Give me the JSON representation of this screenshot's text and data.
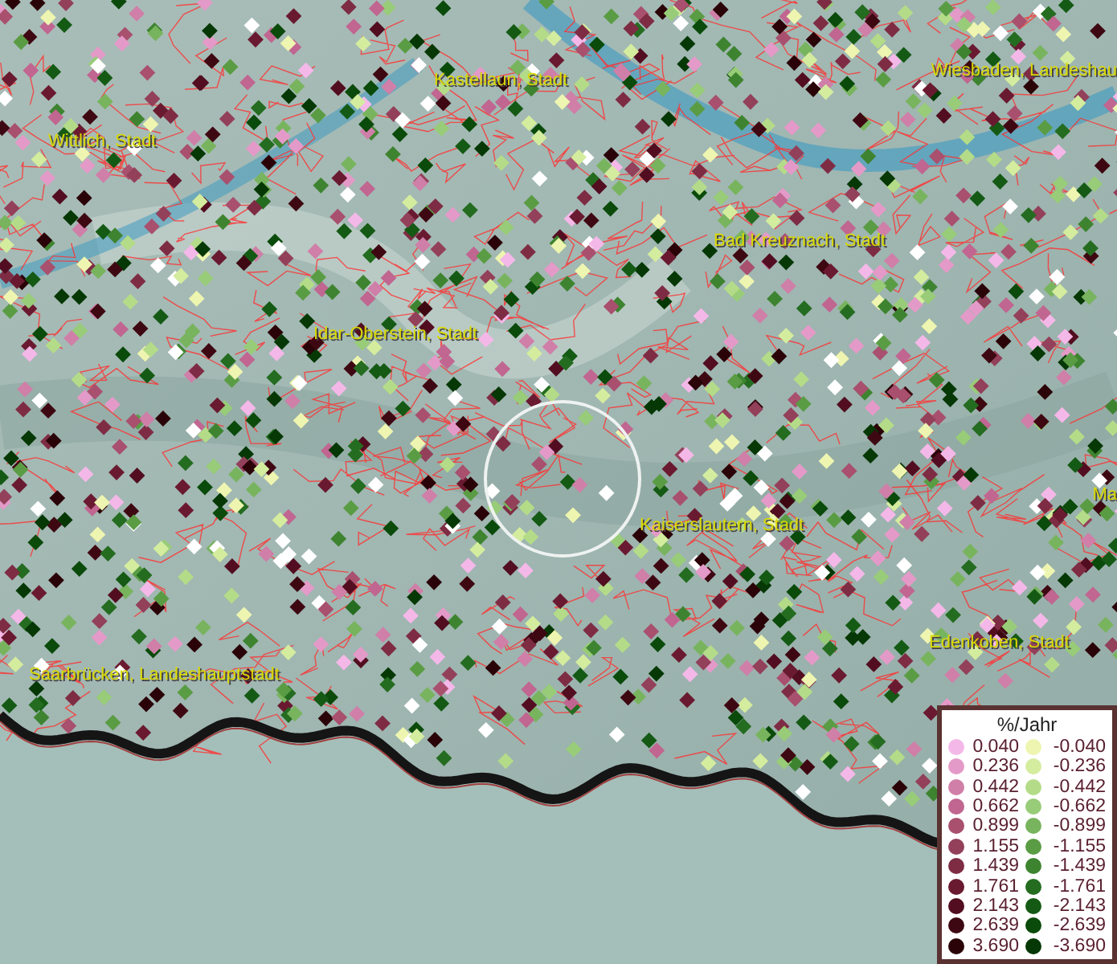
{
  "map": {
    "places": [
      {
        "name": "Kastellaun, Stadt"
      },
      {
        "name": "Wiesbaden, Landeshau"
      },
      {
        "name": "Wittlich, Stadt"
      },
      {
        "name": "Bad Kreuznach, Stadt"
      },
      {
        "name": "Idar-Oberstein, Stadt"
      },
      {
        "name": "Kaiserslautern, Stadt"
      },
      {
        "name": "Ma"
      },
      {
        "name": "Edenkoben, Stadt"
      },
      {
        "name": "Saarbrücken, Landeshauptstadt"
      }
    ]
  },
  "legend": {
    "title": "%/Jahr",
    "positive": [
      {
        "label": "0.040",
        "color": "#f4b8e8"
      },
      {
        "label": "0.236",
        "color": "#e49ac8"
      },
      {
        "label": "0.442",
        "color": "#cf7fa8"
      },
      {
        "label": "0.662",
        "color": "#c06690"
      },
      {
        "label": "0.899",
        "color": "#a8506e"
      },
      {
        "label": "1.155",
        "color": "#93405a"
      },
      {
        "label": "1.439",
        "color": "#7e2c44"
      },
      {
        "label": "1.761",
        "color": "#6a1a30"
      },
      {
        "label": "2.143",
        "color": "#520e20"
      },
      {
        "label": "2.639",
        "color": "#3e0812"
      },
      {
        "label": "3.690",
        "color": "#2a0308"
      }
    ],
    "negative": [
      {
        "label": "-0.040",
        "color": "#eef5b0"
      },
      {
        "label": "-0.236",
        "color": "#d4ec9e"
      },
      {
        "label": "-0.442",
        "color": "#b4dc88"
      },
      {
        "label": "-0.662",
        "color": "#98cc78"
      },
      {
        "label": "-0.899",
        "color": "#78b45e"
      },
      {
        "label": "-1.155",
        "color": "#5a9c44"
      },
      {
        "label": "-1.439",
        "color": "#3e8430"
      },
      {
        "label": "-1.761",
        "color": "#246c20"
      },
      {
        "label": "-2.143",
        "color": "#145a14"
      },
      {
        "label": "-2.639",
        "color": "#0a4a0a"
      },
      {
        "label": "-3.690",
        "color": "#053805"
      }
    ]
  }
}
